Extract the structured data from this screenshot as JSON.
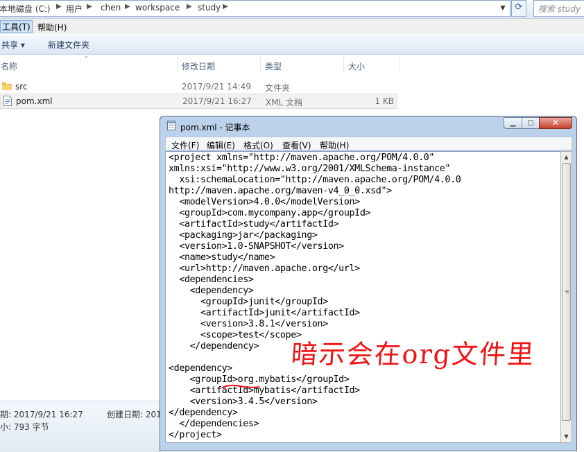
{
  "address": {
    "crumbs": [
      "本地磁盘 (C:)",
      "用户",
      "chen",
      "workspace",
      "study"
    ],
    "search_placeholder": "搜索 study"
  },
  "menubar": {
    "tools": "工具(T)",
    "help": "帮助(H)"
  },
  "toolbar": {
    "share": "共享 ▾",
    "new_folder": "新建文件夹"
  },
  "columns": {
    "name": "名称",
    "modified": "修改日期",
    "type": "类型",
    "size": "大小"
  },
  "files": [
    {
      "name": "src",
      "modified": "2017/9/21 14:49",
      "type": "文件夹",
      "size": ""
    },
    {
      "name": "pom.xml",
      "modified": "2017/9/21 16:27",
      "type": "XML 文档",
      "size": "1 KB"
    }
  ],
  "details": {
    "modified": "期: 2017/9/21 16:27",
    "created": "创建日期: 201",
    "size": "小: 793 字节"
  },
  "notepad": {
    "title": "pom.xml - 记事本",
    "menu": [
      "文件(F)",
      "编辑(E)",
      "格式(O)",
      "查看(V)",
      "帮助(H)"
    ],
    "content": "<project xmlns=\"http://maven.apache.org/POM/4.0.0\"\nxmlns:xsi=\"http://www.w3.org/2001/XMLSchema-instance\"\n  xsi:schemaLocation=\"http://maven.apache.org/POM/4.0.0\nhttp://maven.apache.org/maven-v4_0_0.xsd\">\n  <modelVersion>4.0.0</modelVersion>\n  <groupId>com.mycompany.app</groupId>\n  <artifactId>study</artifactId>\n  <packaging>jar</packaging>\n  <version>1.0-SNAPSHOT</version>\n  <name>study</name>\n  <url>http://maven.apache.org</url>\n  <dependencies>\n    <dependency>\n      <groupId>junit</groupId>\n      <artifactId>junit</artifactId>\n      <version>3.8.1</version>\n      <scope>test</scope>\n    </dependency>\n\n<dependency>\n    <groupId>org.mybatis</groupId>\n    <artifactId>mybatis</artifactId>\n    <version>3.4.5</version>\n</dependency>\n  </dependencies>\n</project>"
  },
  "annotation": {
    "text": "暗示会在org文件里",
    "color": "#ee1414"
  }
}
